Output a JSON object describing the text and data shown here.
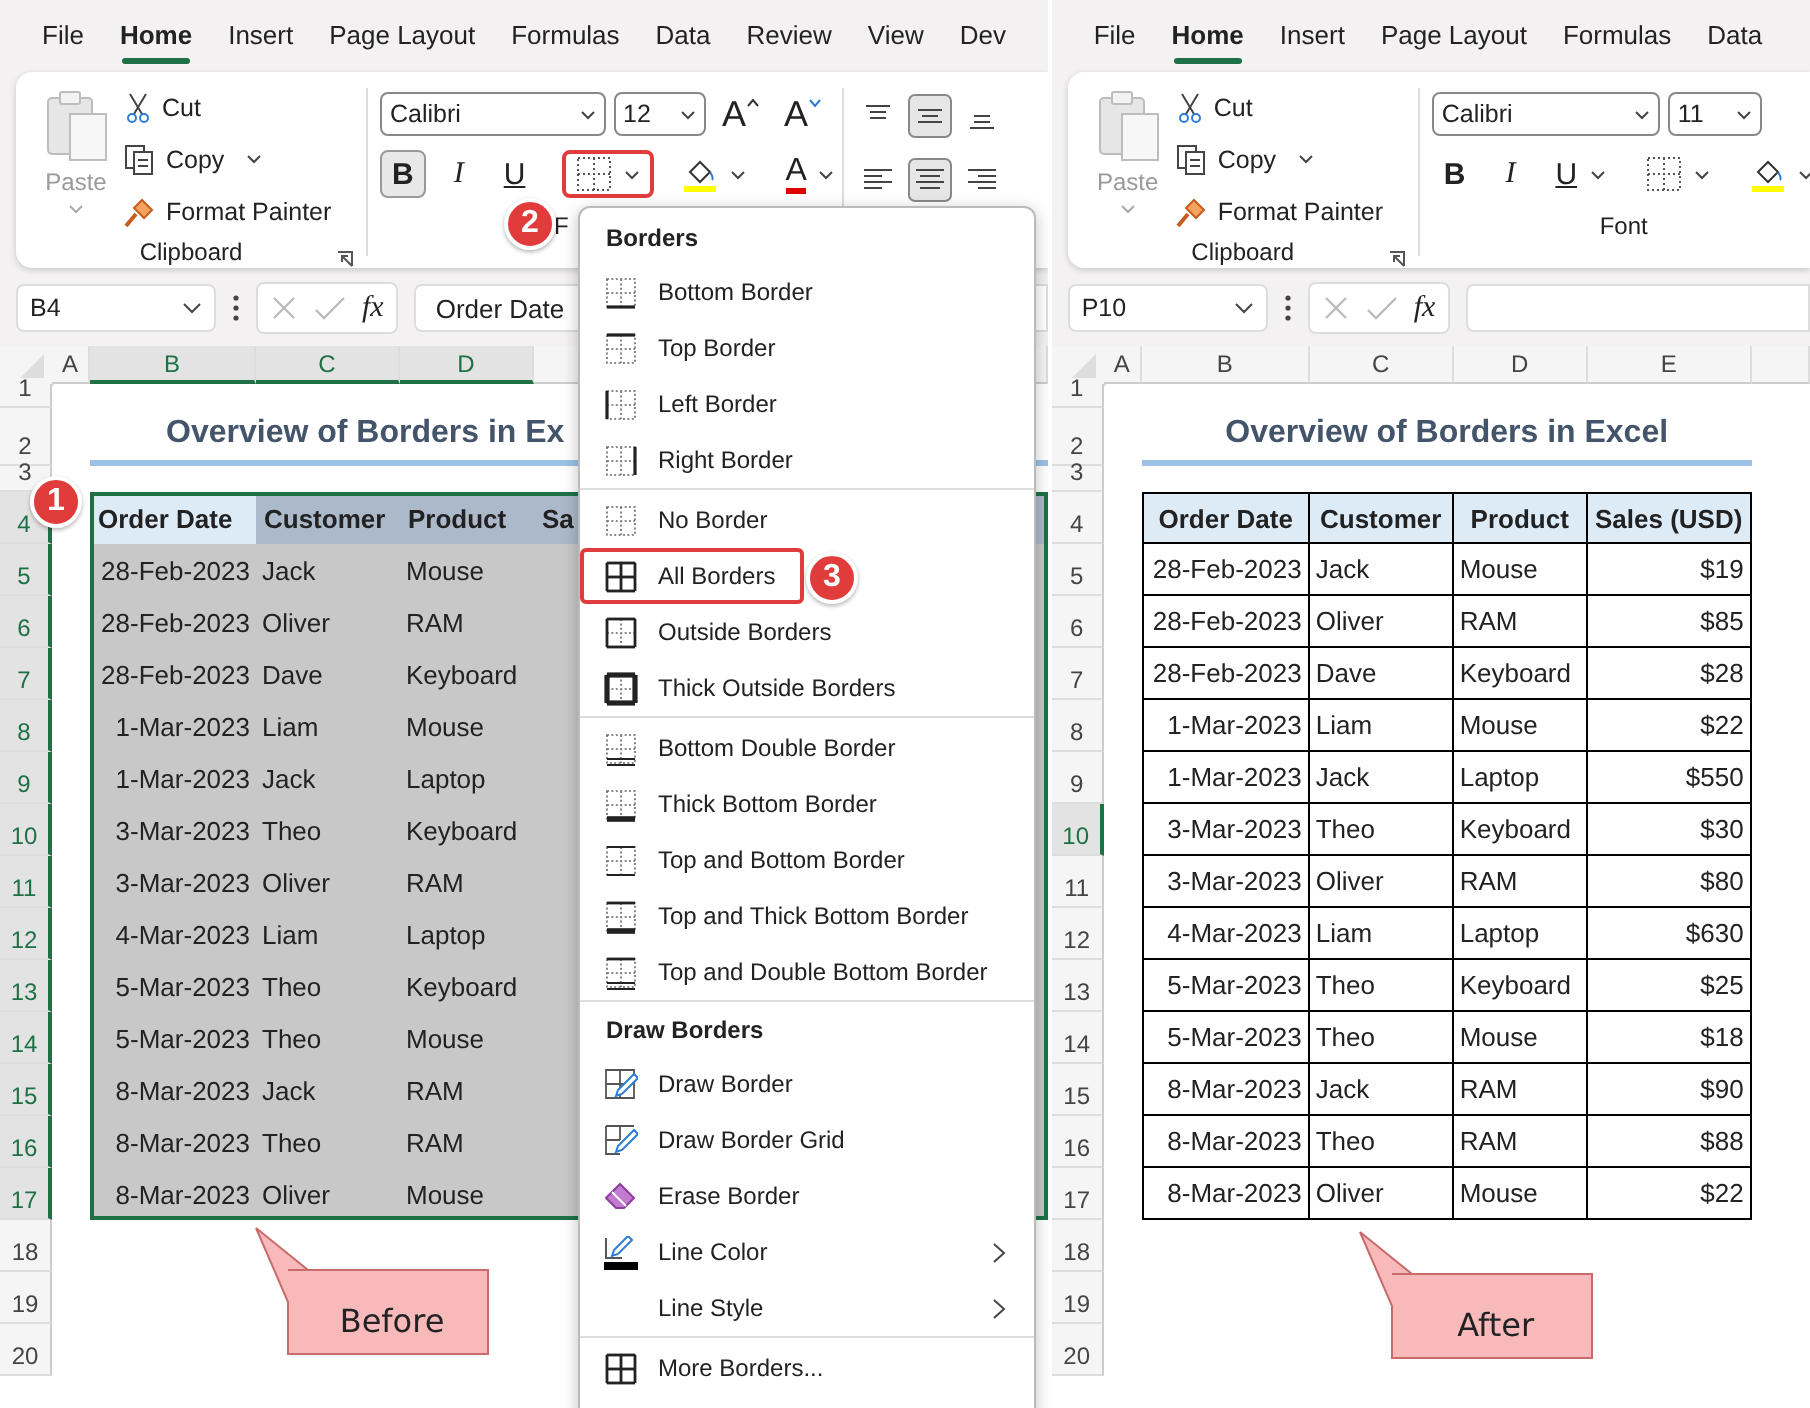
{
  "panels": [
    {
      "tabs": [
        {
          "label": "File",
          "selected": false
        },
        {
          "label": "Home",
          "selected": true
        },
        {
          "label": "Insert",
          "selected": false
        },
        {
          "label": "Page Layout",
          "selected": false
        },
        {
          "label": "Formulas",
          "selected": false
        },
        {
          "label": "Data",
          "selected": false
        },
        {
          "label": "Review",
          "selected": false
        },
        {
          "label": "View",
          "selected": false
        },
        {
          "label": "Dev",
          "selected": false
        }
      ],
      "clipboard": {
        "paste": "Paste",
        "cut": "Cut",
        "copy": "Copy",
        "format_painter": "Format Painter",
        "label": "Clipboard"
      },
      "font": {
        "name": "Calibri",
        "size": "12",
        "label": "F",
        "extras": [
          {
            "kind": "grow",
            "text": "A"
          },
          {
            "kind": "shrink",
            "text": "A"
          }
        ],
        "buttons": [
          {
            "kind": "bold",
            "text": "B",
            "selected": true,
            "caret": false,
            "highlighted": false
          },
          {
            "kind": "italic",
            "text": "I",
            "selected": false,
            "caret": false,
            "highlighted": false
          },
          {
            "kind": "underline",
            "text": "U",
            "selected": false,
            "caret": false,
            "highlighted": false
          },
          {
            "kind": "borders",
            "selected": false,
            "caret": true,
            "highlighted": true
          },
          {
            "kind": "fill",
            "selected": false,
            "caret": true,
            "highlighted": false
          },
          {
            "kind": "font_color",
            "text": "A",
            "selected": false,
            "caret": true,
            "highlighted": false
          }
        ]
      },
      "alignment_group": true,
      "name_box": "B4",
      "fx": "fx",
      "formula": "Order Date",
      "columns": [
        {
          "label": "A",
          "selected": false
        },
        {
          "label": "B",
          "selected": true
        },
        {
          "label": "C",
          "selected": true
        },
        {
          "label": "D",
          "selected": true
        }
      ],
      "rows": [
        {
          "label": "1",
          "selected": false
        },
        {
          "label": "2",
          "selected": false
        },
        {
          "label": "3",
          "selected": false
        },
        {
          "label": "4",
          "selected": true
        },
        {
          "label": "5",
          "selected": true
        },
        {
          "label": "6",
          "selected": true
        },
        {
          "label": "7",
          "selected": true
        },
        {
          "label": "8",
          "selected": true
        },
        {
          "label": "9",
          "selected": true
        },
        {
          "label": "10",
          "selected": true
        },
        {
          "label": "11",
          "selected": true
        },
        {
          "label": "12",
          "selected": true
        },
        {
          "label": "13",
          "selected": true
        },
        {
          "label": "14",
          "selected": true
        },
        {
          "label": "15",
          "selected": true
        },
        {
          "label": "16",
          "selected": true
        },
        {
          "label": "17",
          "selected": true
        },
        {
          "label": "18",
          "selected": false
        },
        {
          "label": "19",
          "selected": false
        },
        {
          "label": "20",
          "selected": false
        }
      ],
      "title": "Overview of Borders in Ex",
      "table": {
        "selected": true,
        "bordered": false,
        "header": [
          "Order Date",
          "Customer",
          "Product",
          "Sa"
        ],
        "rows": [
          [
            "28-Feb-2023",
            "Jack",
            "Mouse"
          ],
          [
            "28-Feb-2023",
            "Oliver",
            "RAM"
          ],
          [
            "28-Feb-2023",
            "Dave",
            "Keyboard"
          ],
          [
            "1-Mar-2023",
            "Liam",
            "Mouse"
          ],
          [
            "1-Mar-2023",
            "Jack",
            "Laptop"
          ],
          [
            "3-Mar-2023",
            "Theo",
            "Keyboard"
          ],
          [
            "3-Mar-2023",
            "Oliver",
            "RAM"
          ],
          [
            "4-Mar-2023",
            "Liam",
            "Laptop"
          ],
          [
            "5-Mar-2023",
            "Theo",
            "Keyboard"
          ],
          [
            "5-Mar-2023",
            "Theo",
            "Mouse"
          ],
          [
            "8-Mar-2023",
            "Jack",
            "RAM"
          ],
          [
            "8-Mar-2023",
            "Theo",
            "RAM"
          ],
          [
            "8-Mar-2023",
            "Oliver",
            "Mouse"
          ]
        ]
      },
      "callout": "Before"
    },
    {
      "tabs": [
        {
          "label": "File",
          "selected": false
        },
        {
          "label": "Home",
          "selected": true
        },
        {
          "label": "Insert",
          "selected": false
        },
        {
          "label": "Page Layout",
          "selected": false
        },
        {
          "label": "Formulas",
          "selected": false
        },
        {
          "label": "Data",
          "selected": false
        }
      ],
      "clipboard": {
        "paste": "Paste",
        "cut": "Cut",
        "copy": "Copy",
        "format_painter": "Format Painter",
        "label": "Clipboard"
      },
      "font": {
        "name": "Calibri",
        "size": "11",
        "label": "Font",
        "buttons": [
          {
            "kind": "bold",
            "text": "B",
            "selected": false,
            "caret": false,
            "highlighted": false
          },
          {
            "kind": "italic",
            "text": "I",
            "selected": false,
            "caret": false,
            "highlighted": false
          },
          {
            "kind": "underline",
            "text": "U",
            "selected": false,
            "caret": true,
            "highlighted": false
          },
          {
            "kind": "borders",
            "selected": false,
            "caret": true,
            "highlighted": false
          },
          {
            "kind": "fill",
            "selected": false,
            "caret": true,
            "highlighted": false
          }
        ]
      },
      "alignment_group": false,
      "name_box": "P10",
      "fx": "fx",
      "columns": [
        {
          "label": "A",
          "selected": false
        },
        {
          "label": "B",
          "selected": false
        },
        {
          "label": "C",
          "selected": false
        },
        {
          "label": "D",
          "selected": false
        },
        {
          "label": "E",
          "selected": false
        }
      ],
      "rows": [
        {
          "label": "1",
          "selected": false
        },
        {
          "label": "2",
          "selected": false
        },
        {
          "label": "3",
          "selected": false
        },
        {
          "label": "4",
          "selected": false
        },
        {
          "label": "5",
          "selected": false
        },
        {
          "label": "6",
          "selected": false
        },
        {
          "label": "7",
          "selected": false
        },
        {
          "label": "8",
          "selected": false
        },
        {
          "label": "9",
          "selected": false
        },
        {
          "label": "10",
          "selected": true
        },
        {
          "label": "11",
          "selected": false
        },
        {
          "label": "12",
          "selected": false
        },
        {
          "label": "13",
          "selected": false
        },
        {
          "label": "14",
          "selected": false
        },
        {
          "label": "15",
          "selected": false
        },
        {
          "label": "16",
          "selected": false
        },
        {
          "label": "17",
          "selected": false
        },
        {
          "label": "18",
          "selected": false
        },
        {
          "label": "19",
          "selected": false
        },
        {
          "label": "20",
          "selected": false
        }
      ],
      "title": "Overview of Borders in Excel",
      "table": {
        "selected": false,
        "bordered": true,
        "header": [
          "Order Date",
          "Customer",
          "Product",
          "Sales (USD)"
        ],
        "rows": [
          [
            "28-Feb-2023",
            "Jack",
            "Mouse",
            "$19"
          ],
          [
            "28-Feb-2023",
            "Oliver",
            "RAM",
            "$85"
          ],
          [
            "28-Feb-2023",
            "Dave",
            "Keyboard",
            "$28"
          ],
          [
            "1-Mar-2023",
            "Liam",
            "Mouse",
            "$22"
          ],
          [
            "1-Mar-2023",
            "Jack",
            "Laptop",
            "$550"
          ],
          [
            "3-Mar-2023",
            "Theo",
            "Keyboard",
            "$30"
          ],
          [
            "3-Mar-2023",
            "Oliver",
            "RAM",
            "$80"
          ],
          [
            "4-Mar-2023",
            "Liam",
            "Laptop",
            "$630"
          ],
          [
            "5-Mar-2023",
            "Theo",
            "Keyboard",
            "$25"
          ],
          [
            "5-Mar-2023",
            "Theo",
            "Mouse",
            "$18"
          ],
          [
            "8-Mar-2023",
            "Jack",
            "RAM",
            "$90"
          ],
          [
            "8-Mar-2023",
            "Theo",
            "RAM",
            "$88"
          ],
          [
            "8-Mar-2023",
            "Oliver",
            "Mouse",
            "$22"
          ]
        ]
      },
      "callout": "After"
    }
  ],
  "menu": {
    "groups": [
      {
        "title": "Borders",
        "items": [
          {
            "label": "Bottom Border",
            "selected": false,
            "submenu": false
          },
          {
            "label": "Top Border",
            "selected": false,
            "submenu": false
          },
          {
            "label": "Left Border",
            "selected": false,
            "submenu": false
          },
          {
            "label": "Right Border",
            "selected": false,
            "submenu": false
          }
        ]
      },
      {
        "items": [
          {
            "label": "No Border",
            "selected": false,
            "submenu": false
          },
          {
            "label": "All Borders",
            "selected": true,
            "submenu": false
          },
          {
            "label": "Outside Borders",
            "selected": false,
            "submenu": false
          },
          {
            "label": "Thick Outside Borders",
            "selected": false,
            "submenu": false
          }
        ]
      },
      {
        "items": [
          {
            "label": "Bottom Double Border",
            "selected": false,
            "submenu": false
          },
          {
            "label": "Thick Bottom Border",
            "selected": false,
            "submenu": false
          },
          {
            "label": "Top and Bottom Border",
            "selected": false,
            "submenu": false
          },
          {
            "label": "Top and Thick Bottom Border",
            "selected": false,
            "submenu": false
          },
          {
            "label": "Top and Double Bottom Border",
            "selected": false,
            "submenu": false
          }
        ]
      },
      {
        "title": "Draw Borders",
        "items": [
          {
            "label": "Draw Border",
            "selected": false,
            "submenu": false
          },
          {
            "label": "Draw Border Grid",
            "selected": false,
            "submenu": false
          },
          {
            "label": "Erase Border",
            "selected": false,
            "submenu": false
          },
          {
            "label": "Line Color",
            "selected": false,
            "submenu": true
          },
          {
            "label": "Line Style",
            "selected": false,
            "submenu": true
          }
        ]
      },
      {
        "items": [
          {
            "label": "More Borders...",
            "selected": false,
            "submenu": false
          }
        ]
      }
    ]
  },
  "steps": [
    "1",
    "2",
    "3"
  ]
}
